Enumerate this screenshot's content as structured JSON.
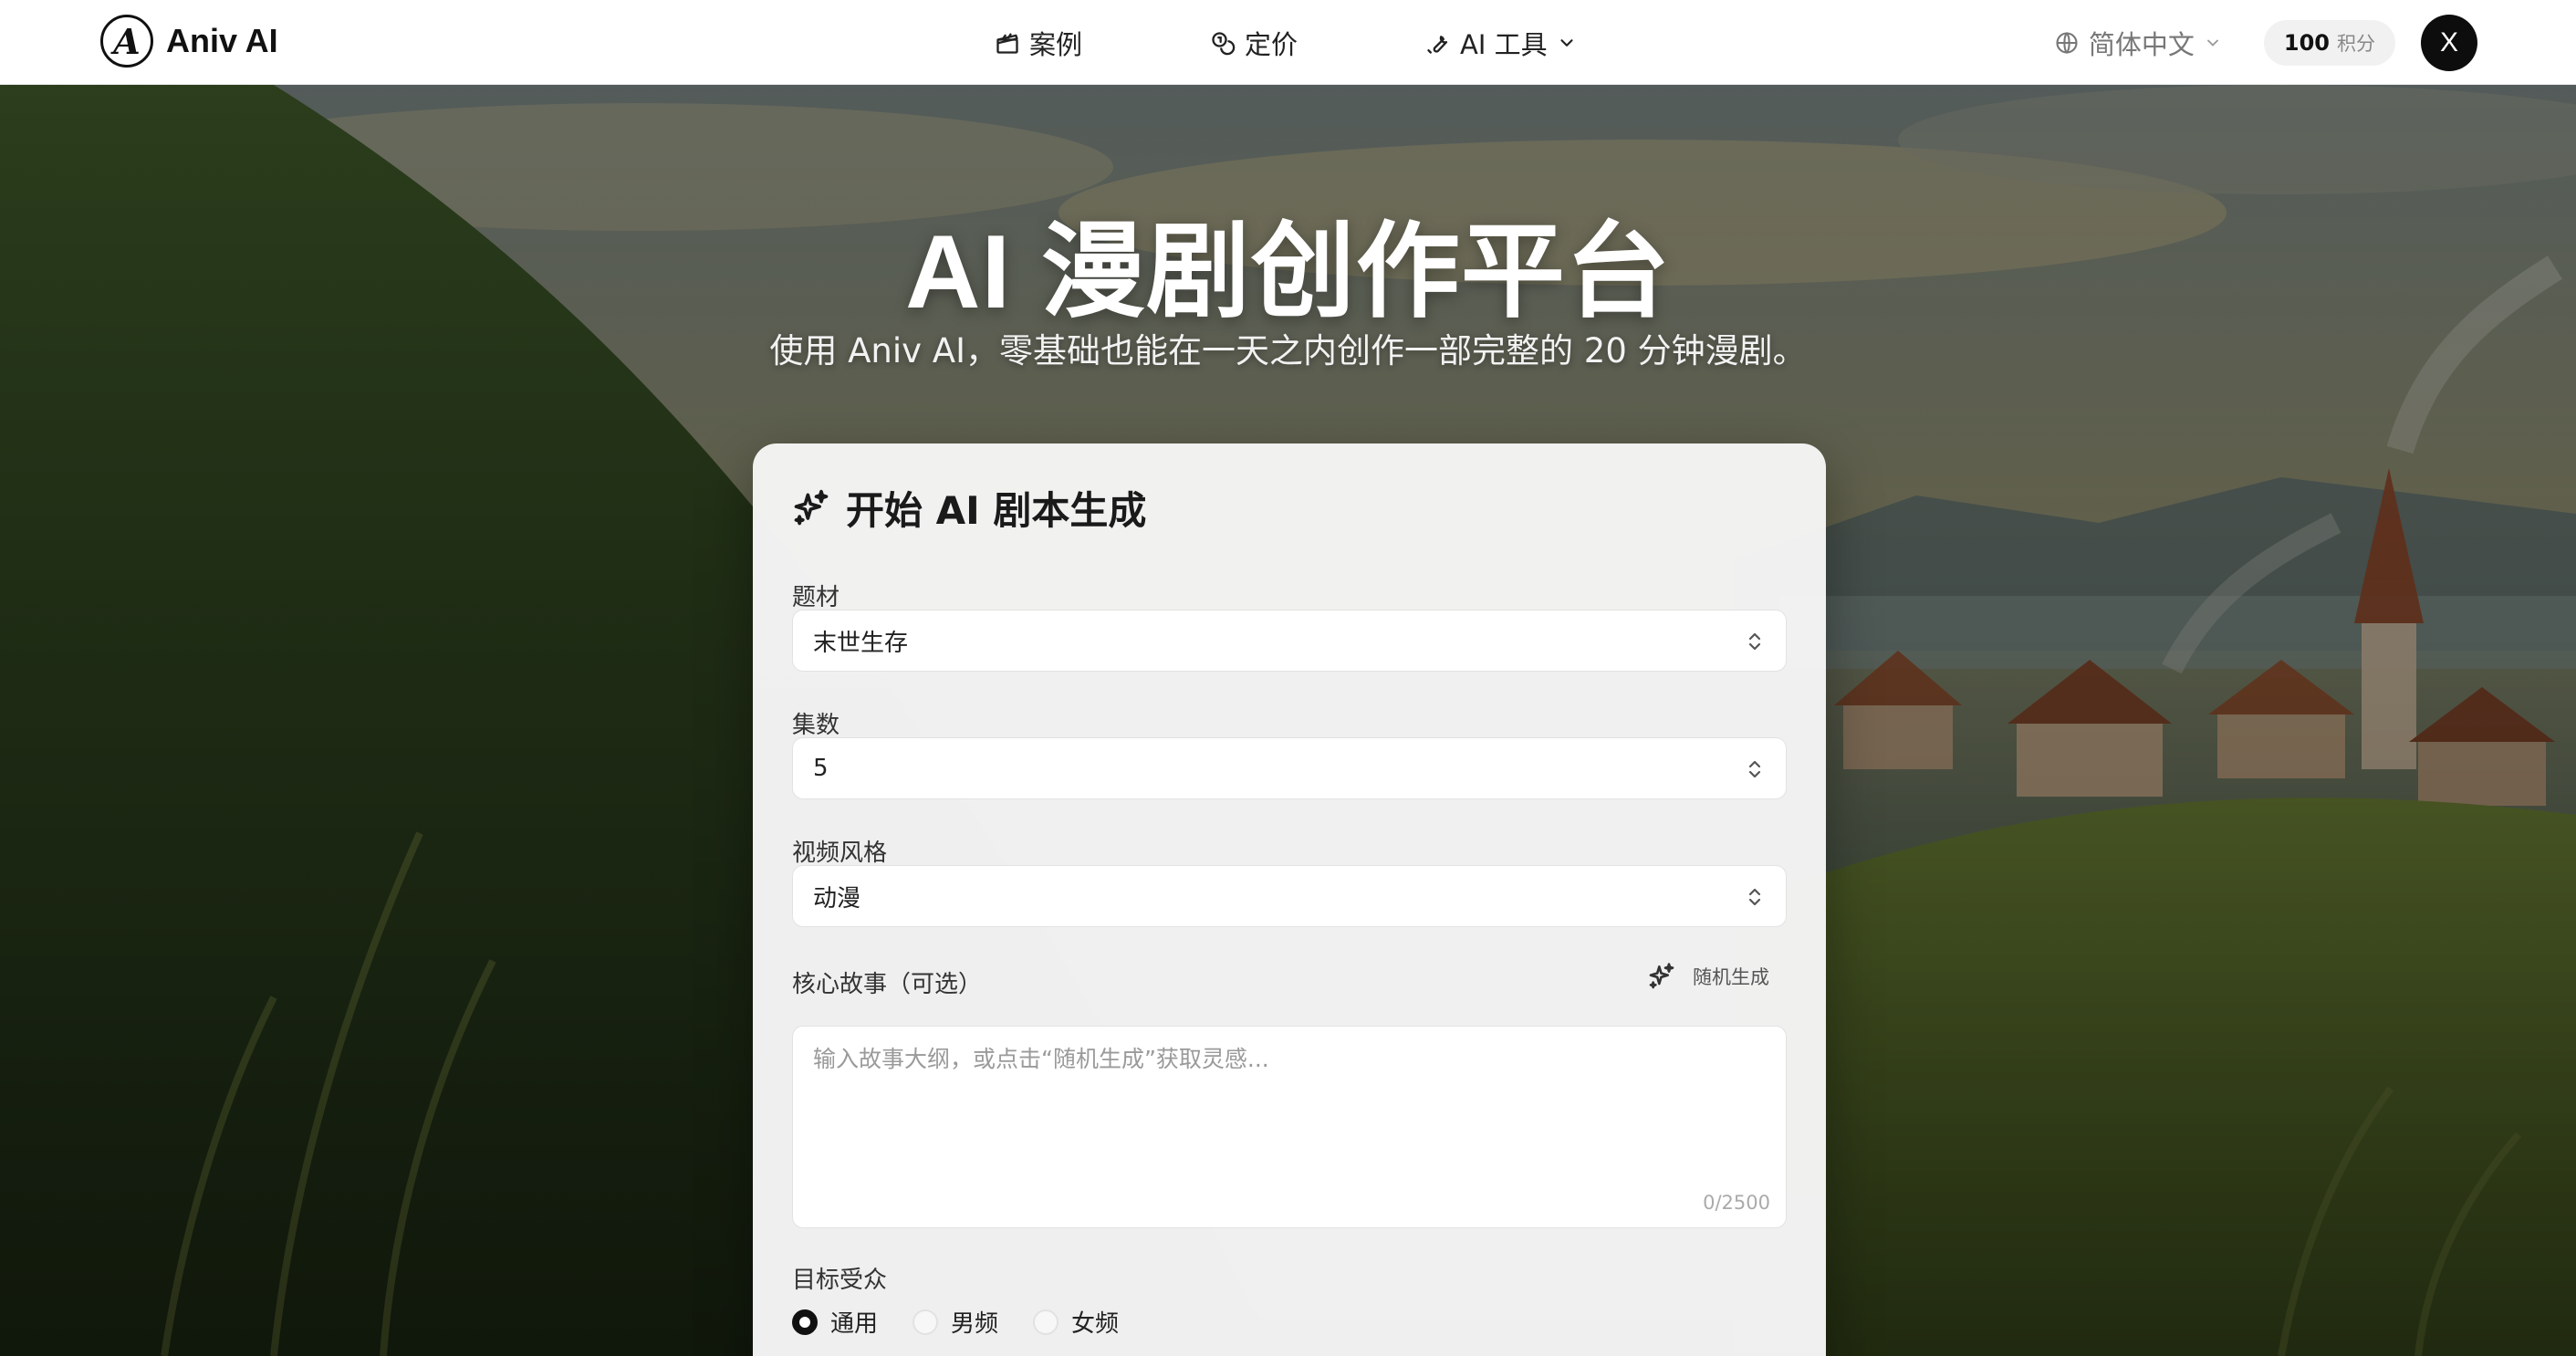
{
  "brand": {
    "name": "Aniv AI",
    "logo_letter": "A"
  },
  "nav": {
    "items": [
      {
        "label": "案例",
        "icon": "clapperboard-icon"
      },
      {
        "label": "定价",
        "icon": "coins-icon"
      },
      {
        "label": "AI 工具",
        "icon": "wrench-icon"
      }
    ],
    "language": "简体中文",
    "credits_value": "100",
    "credits_unit": "积分",
    "avatar_letter": "X"
  },
  "hero": {
    "title": "AI 漫剧创作平台",
    "subtitle": "使用 Aniv AI，零基础也能在一天之内创作一部完整的 20 分钟漫剧。"
  },
  "form": {
    "title": "开始 AI 剧本生成",
    "genre": {
      "label": "题材",
      "value": "末世生存"
    },
    "episodes": {
      "label": "集数",
      "value": "5"
    },
    "style": {
      "label": "视频风格",
      "value": "动漫"
    },
    "story": {
      "label": "核心故事（可选）",
      "random_label": "随机生成",
      "placeholder": "输入故事大纲，或点击“随机生成”获取灵感...",
      "counter": "0/2500"
    },
    "audience": {
      "label": "目标受众",
      "options": [
        "通用",
        "男频",
        "女频"
      ],
      "selected": "通用"
    }
  },
  "colors": {
    "nav_bg": "#ffffff",
    "card_bg": "#f4f4f4",
    "accent_dark": "#111111"
  }
}
